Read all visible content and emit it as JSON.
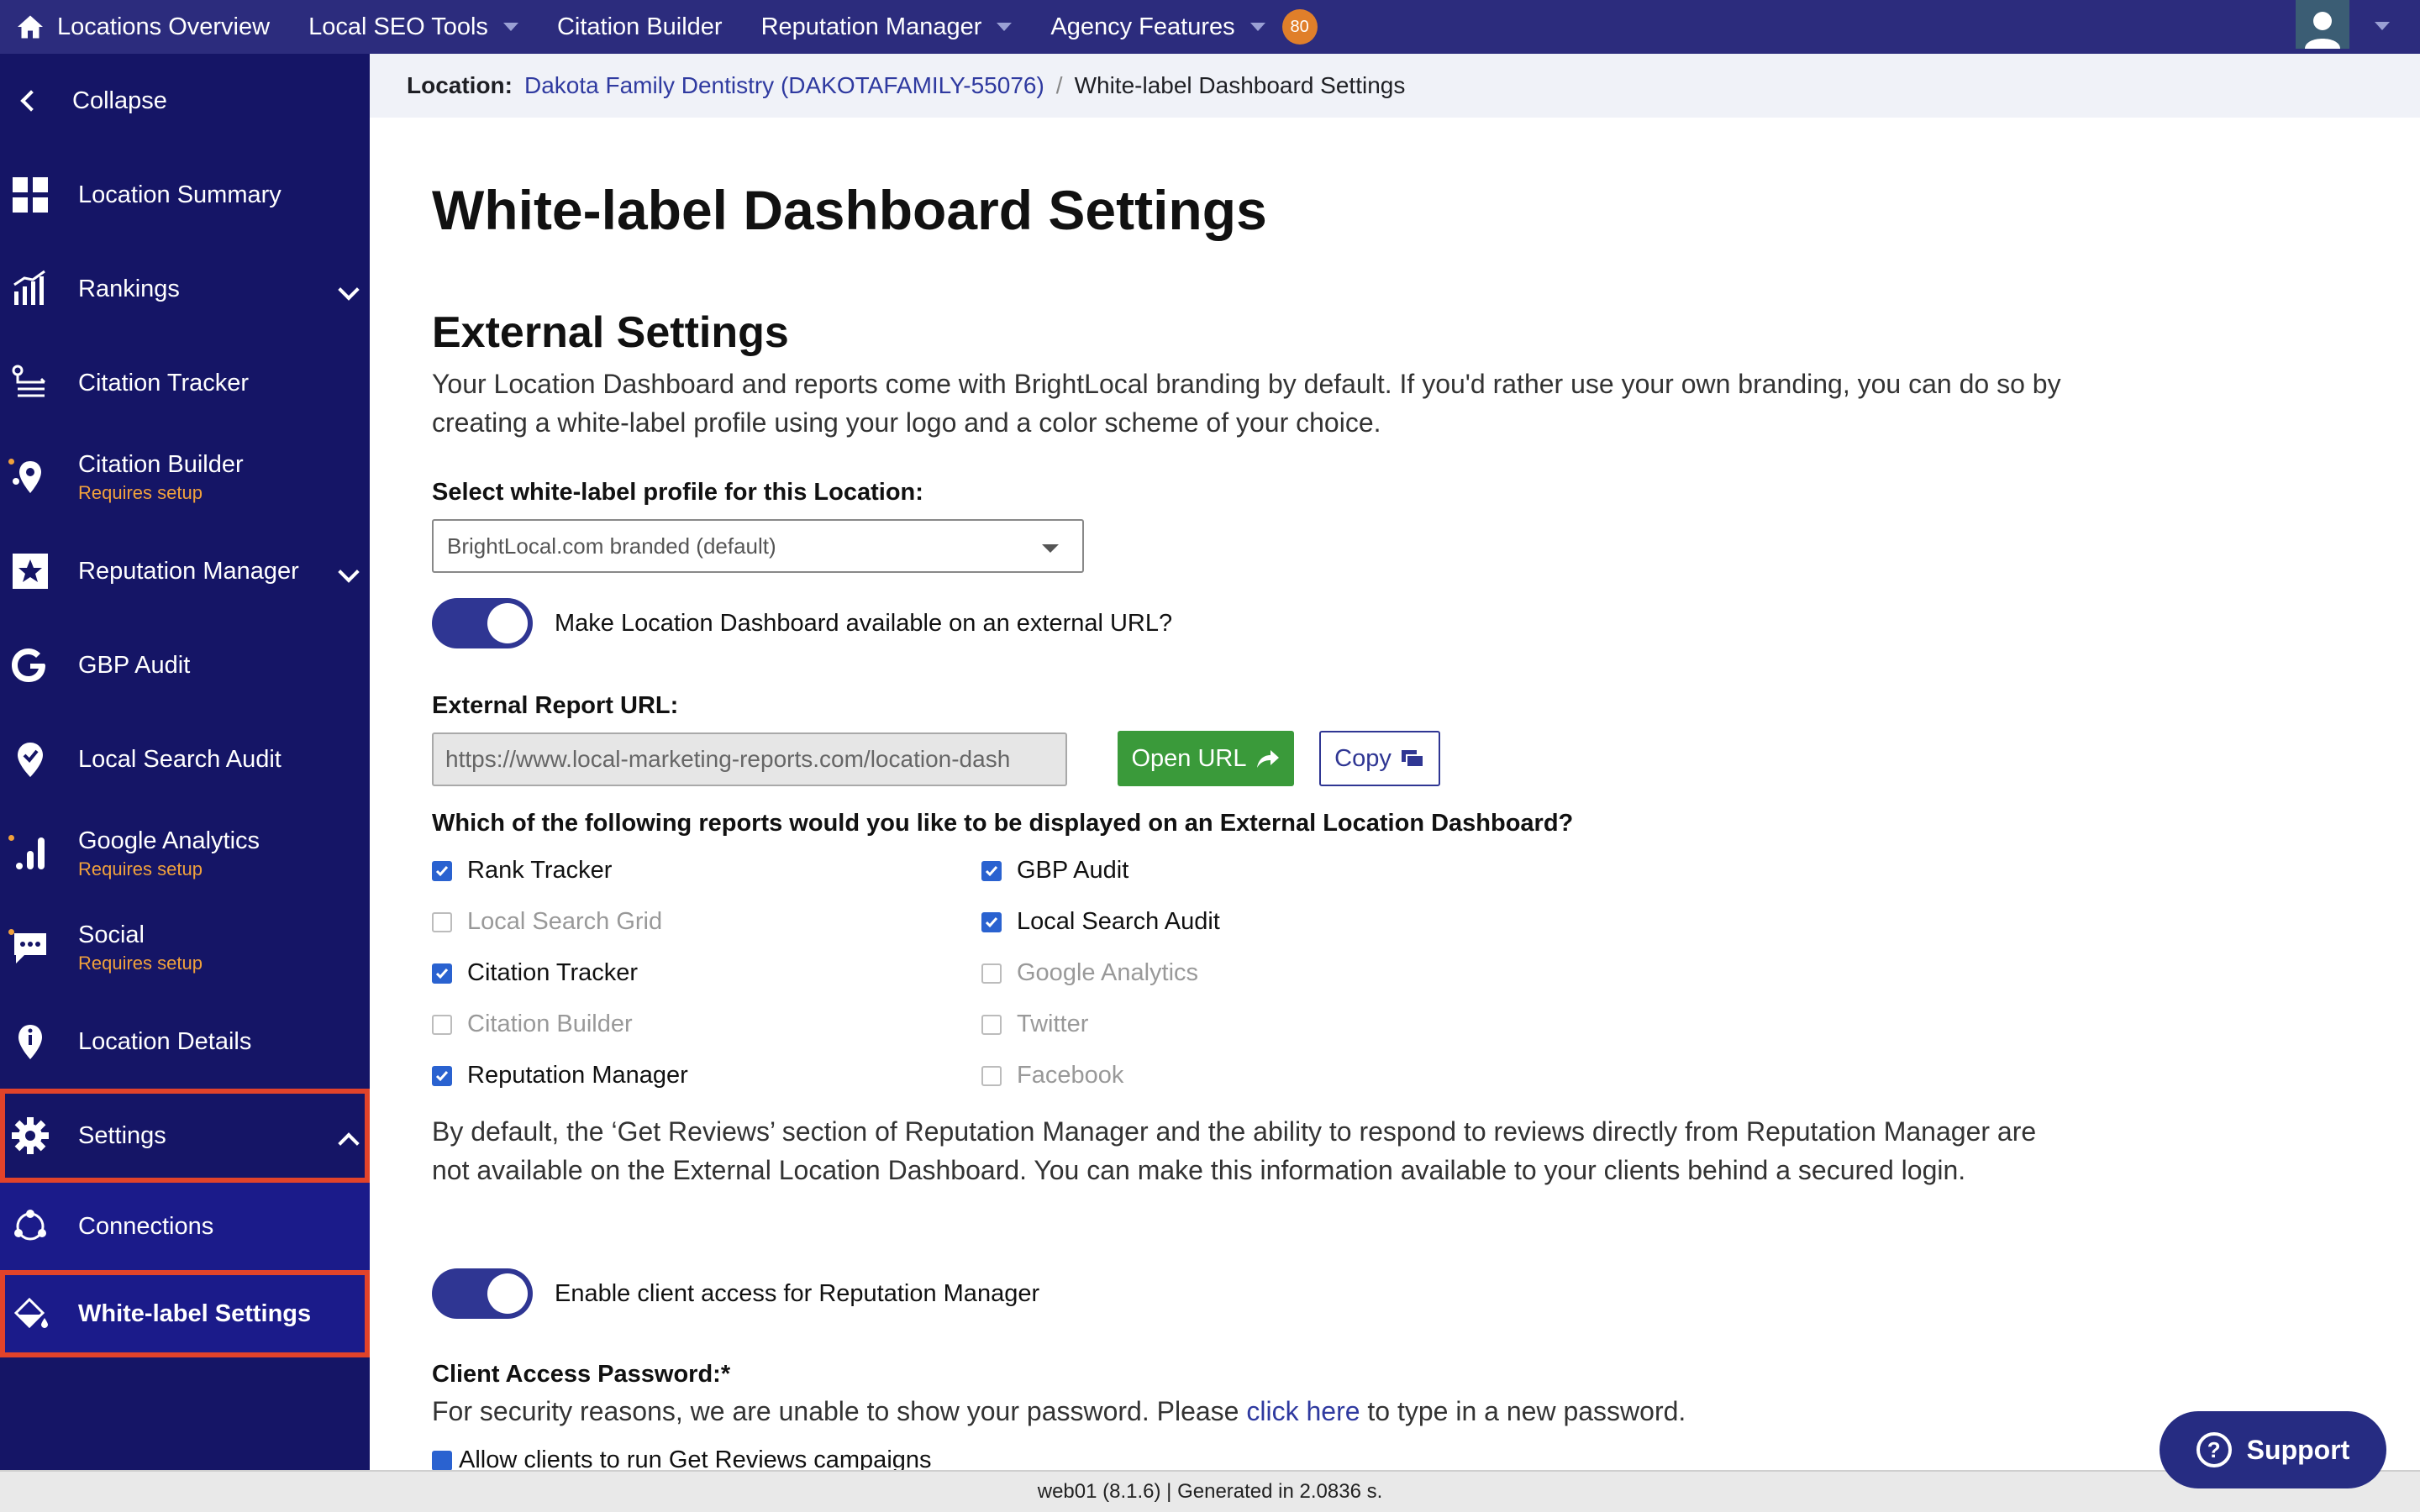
{
  "topnav": {
    "items": [
      {
        "label": "Locations Overview"
      },
      {
        "label": "Local SEO Tools"
      },
      {
        "label": "Citation Builder"
      },
      {
        "label": "Reputation Manager"
      },
      {
        "label": "Agency Features"
      }
    ],
    "badge_count": "80"
  },
  "sidebar": {
    "collapse_label": "Collapse",
    "items": [
      {
        "label": "Location Summary"
      },
      {
        "label": "Rankings"
      },
      {
        "label": "Citation Tracker"
      },
      {
        "label": "Citation Builder",
        "sub": "Requires setup"
      },
      {
        "label": "Reputation Manager"
      },
      {
        "label": "GBP Audit"
      },
      {
        "label": "Local Search Audit"
      },
      {
        "label": "Google Analytics",
        "sub": "Requires setup"
      },
      {
        "label": "Social",
        "sub": "Requires setup"
      },
      {
        "label": "Location Details"
      },
      {
        "label": "Settings"
      },
      {
        "label": "Connections"
      },
      {
        "label": "White-label Settings"
      }
    ]
  },
  "breadcrumb": {
    "label": "Location:",
    "location": "Dakota Family Dentistry (DAKOTAFAMILY-55076)",
    "separator": "/",
    "current": "White-label Dashboard Settings"
  },
  "main": {
    "title": "White-label Dashboard Settings",
    "section_title": "External Settings",
    "description": "Your Location Dashboard and reports come with BrightLocal branding by default. If you'd rather use your own branding, you can do so by creating a white-label profile using your logo and a color scheme of your choice.",
    "profile_label": "Select white-label profile for this Location:",
    "profile_value": "BrightLocal.com branded (default)",
    "external_toggle_label": "Make Location Dashboard available on an external URL?",
    "external_url_label": "External Report URL:",
    "external_url_value": "https://www.local-marketing-reports.com/location-dash",
    "open_url_label": "Open URL",
    "copy_label": "Copy",
    "reports_question": "Which of the following reports would you like to be displayed on an External Location Dashboard?",
    "reports_left": [
      {
        "label": "Rank Tracker",
        "checked": true
      },
      {
        "label": "Local Search Grid",
        "checked": false
      },
      {
        "label": "Citation Tracker",
        "checked": true
      },
      {
        "label": "Citation Builder",
        "checked": false
      },
      {
        "label": "Reputation Manager",
        "checked": true
      }
    ],
    "reports_right": [
      {
        "label": "GBP Audit",
        "checked": true
      },
      {
        "label": "Local Search Audit",
        "checked": true
      },
      {
        "label": "Google Analytics",
        "checked": false
      },
      {
        "label": "Twitter",
        "checked": false
      },
      {
        "label": "Facebook",
        "checked": false
      }
    ],
    "note": "By default, the ‘Get Reviews’ section of Reputation Manager and the ability to respond to reviews directly from Reputation Manager are not available on the External Location Dashboard. You can make this information available to your clients behind a secured login.",
    "client_access_label": "Enable client access for Reputation Manager",
    "password_label": "Client Access Password:*",
    "password_text_before": "For security reasons, we are unable to show your password. Please",
    "password_link": "click here",
    "password_text_after": "to type in a new password.",
    "partial_checkbox_label": "Allow clients to run Get Reviews campaigns"
  },
  "footer": {
    "text": "web01 (8.1.6) | Generated in 2.0836 s."
  },
  "support": {
    "label": "Support"
  },
  "colors": {
    "nav": "#2c2c7d",
    "sidebar": "#151566",
    "accent": "#2f3693",
    "highlight": "#e2432a",
    "setup": "#f0a13c",
    "open_button": "#3a9a3a"
  }
}
